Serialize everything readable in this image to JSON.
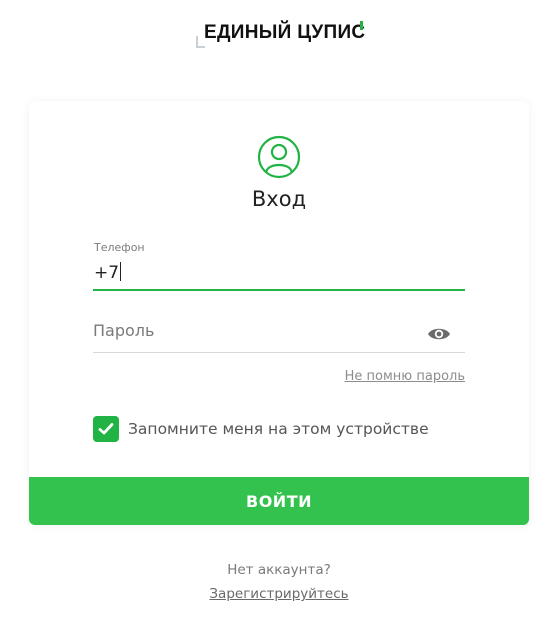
{
  "header": {
    "logo_text": "ЕДИНЫЙ ЦУПИС",
    "accent_color": "#22b345"
  },
  "form": {
    "icon": "user-circle-icon",
    "title": "Вход",
    "phone": {
      "label": "Телефон",
      "value": "+7"
    },
    "password": {
      "placeholder": "Пароль",
      "toggle_icon": "eye-icon"
    },
    "forgot_link": "Не помню пароль",
    "remember": {
      "checked": true,
      "label": "Запомните меня на этом устройстве"
    },
    "submit_label": "ВОЙТИ",
    "button_color": "#34c24e"
  },
  "footer": {
    "no_account_text": "Нет аккаунта?",
    "register_link": "Зарегистрируйтесь"
  }
}
